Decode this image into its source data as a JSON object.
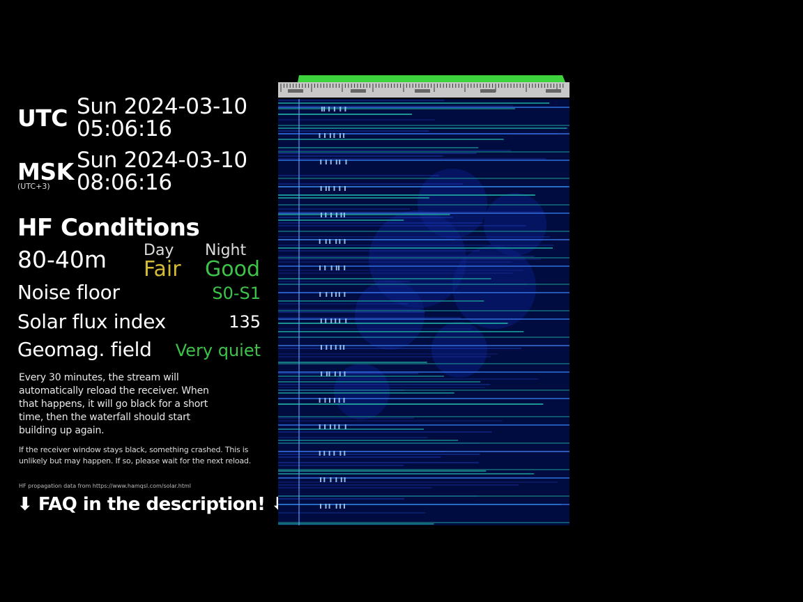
{
  "clocks": [
    {
      "label": "UTC",
      "sublabel": "",
      "date": "Sun 2024-03-10",
      "time": "05:06:16"
    },
    {
      "label": "MSK",
      "sublabel": "(UTC+3)",
      "date": "Sun 2024-03-10",
      "time": "08:06:16"
    }
  ],
  "hf": {
    "title": "HF Conditions",
    "band": "80-40m",
    "day_header": "Day",
    "night_header": "Night",
    "day_value": "Fair",
    "night_value": "Good",
    "noise_floor_label": "Noise floor",
    "noise_floor_value": "S0-S1",
    "solar_flux_label": "Solar flux index",
    "solar_flux_value": "135",
    "geomag_label": "Geomag. field",
    "geomag_value": "Very quiet"
  },
  "notes": {
    "reload_info": "Every 30 minutes, the stream will automatically reload the receiver. When that happens, it will go black for a short time, then the waterfall should start building up again.",
    "crash_info": "If the receiver window stays black, something crashed. This is unlikely but may happen. If so, please wait for the next reload.",
    "source": "HF propagation data from https://www.hamqsl.com/solar.html",
    "faq": "⬇ FAQ in the description! ⬇"
  },
  "colors": {
    "fair": "#d4bb38",
    "good": "#3ec34a",
    "waterfall_bg": "#000c40",
    "scale_bg": "#c8c8c8",
    "passband": "#3ed33e"
  }
}
